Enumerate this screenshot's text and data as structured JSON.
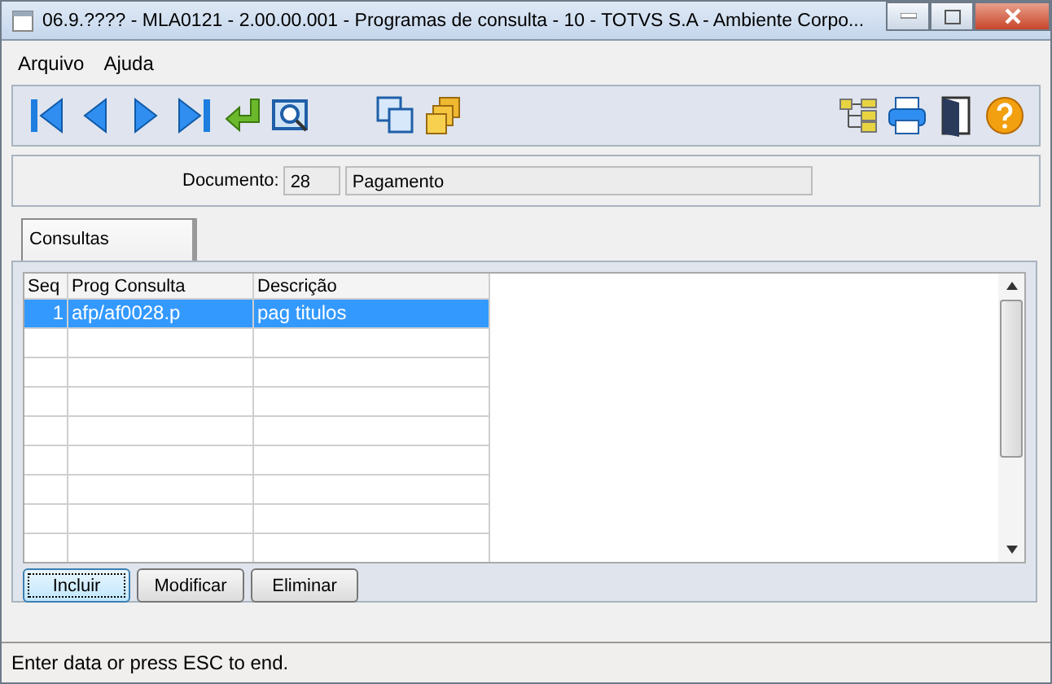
{
  "window": {
    "title": "06.9.???? - MLA0121 - 2.00.00.001 - Programas de consulta - 10 - TOTVS S.A - Ambiente Corpo..."
  },
  "menu": [
    "Arquivo",
    "Ajuda"
  ],
  "document": {
    "label": "Documento:",
    "code": "28",
    "name": "Pagamento"
  },
  "tabs": [
    {
      "label": "Consultas",
      "selected": true
    }
  ],
  "table": {
    "columns": [
      "Seq",
      "Prog Consulta",
      "Descrição"
    ],
    "rows": [
      {
        "cells": [
          "1",
          "afp/af0028.p",
          "pag titulos"
        ],
        "selected": true
      }
    ]
  },
  "buttons": [
    "Incluir",
    "Modificar",
    "Eliminar"
  ],
  "status_bar": "Enter data or press ESC to end."
}
